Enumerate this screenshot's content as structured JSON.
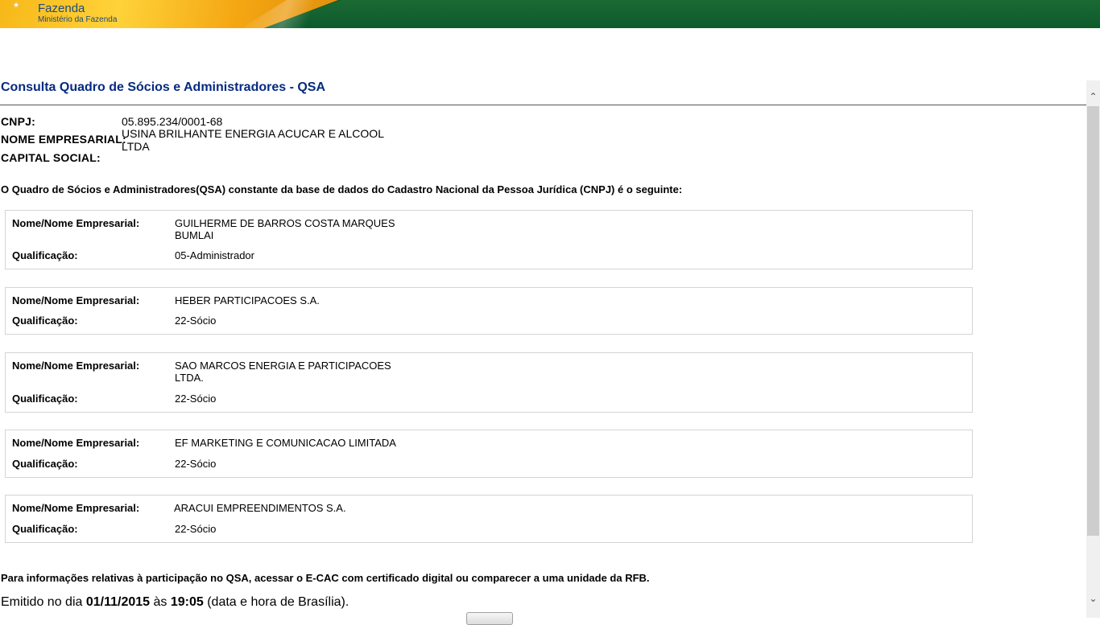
{
  "header": {
    "brand_title": "Fazenda",
    "brand_subtitle": "Ministério da Fazenda"
  },
  "page": {
    "title": "Consulta Quadro de Sócios e Administradores - QSA"
  },
  "company": {
    "cnpj_label": "CNPJ:",
    "cnpj_value": "05.895.234/0001-68",
    "name_label": "NOME EMPRESARIAL:",
    "name_value_line1": "USINA BRILHANTE ENERGIA ACUCAR E ALCOOL",
    "name_value_line2": "LTDA",
    "capital_label": "CAPITAL SOCIAL:",
    "capital_value": ""
  },
  "intro_text": "O Quadro de Sócios e Administradores(QSA) constante da base de dados do Cadastro Nacional da Pessoa Jurídica (CNPJ) é o seguinte:",
  "partners": [
    {
      "name_label": "Nome/Nome Empresarial:",
      "name_line1": "GUILHERME DE BARROS COSTA MARQUES",
      "name_line2": "BUMLAI",
      "qual_label": "Qualificação:",
      "qualification": "05-Administrador"
    },
    {
      "name_label": "Nome/Nome Empresarial:",
      "name_line1": "HEBER PARTICIPACOES S.A.",
      "name_line2": "",
      "qual_label": "Qualificação:",
      "qualification": "22-Sócio"
    },
    {
      "name_label": "Nome/Nome Empresarial:",
      "name_line1": "SAO MARCOS ENERGIA E PARTICIPACOES",
      "name_line2": "LTDA.",
      "qual_label": "Qualificação:",
      "qualification": "22-Sócio"
    },
    {
      "name_label": "Nome/Nome Empresarial:",
      "name_line1": "EF MARKETING E COMUNICACAO LIMITADA",
      "name_line2": "",
      "qual_label": "Qualificação:",
      "qualification": "22-Sócio"
    },
    {
      "name_label": "Nome/Nome Empresarial:",
      "name_line1": "ARACUI EMPREENDIMENTOS S.A.",
      "name_line2": "",
      "qual_label": "Qualificação:",
      "qualification": "22-Sócio"
    }
  ],
  "footer": {
    "note": "Para informações relativas à participação no QSA, acessar o E-CAC com certificado digital ou comparecer a uma unidade da RFB.",
    "emitted_prefix": "Emitido no dia ",
    "emitted_date": "01/11/2015",
    "emitted_mid": " às ",
    "emitted_time": "19:05",
    "emitted_suffix": " (data e hora de Brasília)."
  },
  "icons": {
    "scroll_up": "chevron-up-icon",
    "scroll_down": "chevron-down-icon",
    "brand_star": "star-icon"
  }
}
